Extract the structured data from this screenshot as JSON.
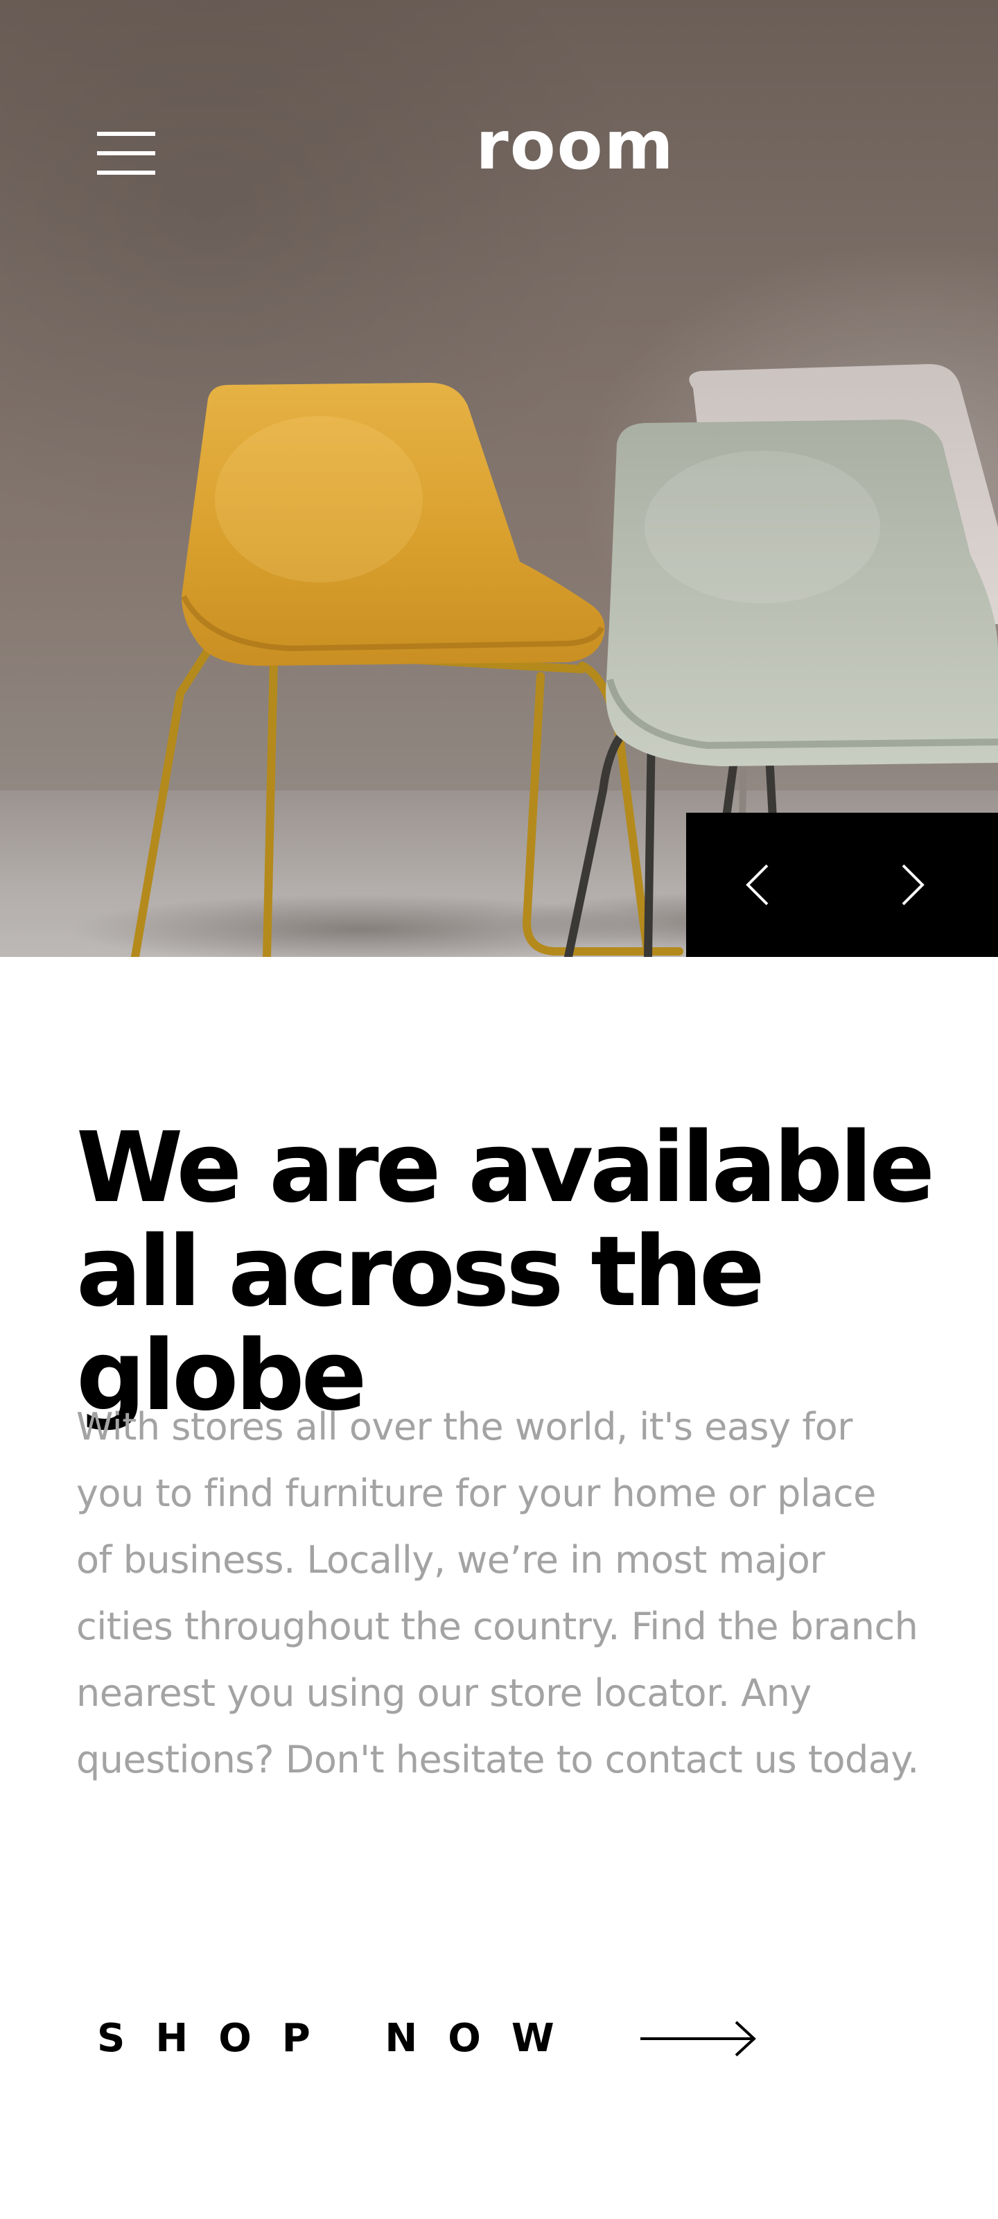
{
  "header": {
    "logo_text": "room",
    "menu_icon": "hamburger-menu-icon"
  },
  "hero": {
    "image_subject": "chairs-photo",
    "prev_icon": "chevron-left-icon",
    "next_icon": "chevron-right-icon",
    "controls_background": "#000000"
  },
  "content": {
    "headline_line1": "We are available",
    "headline_line2": "all across the globe",
    "body": "With stores all over the world, it's easy for you to find furniture for your home or place of business. Locally, we’re in most major cities throughout the country. Find the branch nearest you using our store locator. Any questions? Don't hesitate to contact us today.",
    "cta_label": "SHOP NOW",
    "cta_icon": "arrow-right-icon"
  },
  "colors": {
    "text_primary": "#000000",
    "text_secondary": "#a3a3a3",
    "background": "#ffffff",
    "chair_yellow": "#e0a93a",
    "chair_sage": "#b7bdb0",
    "chair_pink": "#d6cfcc"
  }
}
